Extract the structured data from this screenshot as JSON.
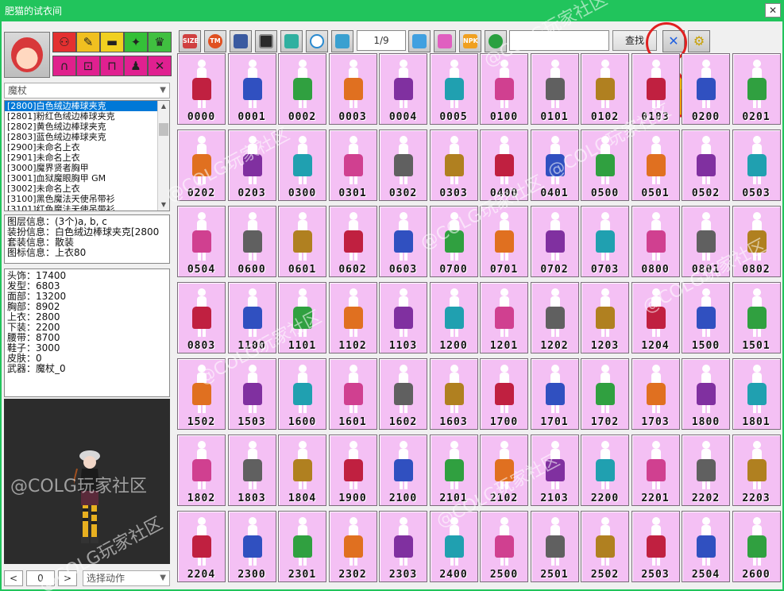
{
  "window": {
    "title": "肥猫的试衣间",
    "close_label": "✕"
  },
  "left": {
    "part_buttons": [
      "head-cap",
      "hair",
      "face",
      "neck",
      "coat",
      "pants",
      "belt",
      "shoes",
      "skin",
      "weapon"
    ],
    "weapon_select": "魔杖",
    "items": [
      "[2800]白色绒边棒球夹克",
      "[2801]粉红色绒边棒球夹克",
      "[2802]黄色绒边棒球夹克",
      "[2803]蓝色绒边棒球夹克",
      "[2900]未命名上衣",
      "[2901]未命名上衣",
      "[3000]魔界贤者胸甲",
      "[3001]血狱魔眼胸甲 GM",
      "[3002]未命名上衣",
      "[3100]黑色魔法天使吊带衫",
      "[3101]红色魔法天使吊带衫"
    ],
    "info": [
      "图层信息：(3个)a, b, c",
      "装扮信息：白色绒边棒球夹克[2800",
      "套装信息：散装",
      "图标信息：上衣80"
    ],
    "stats": [
      "头饰：17400",
      "发型：6803",
      "面部：13200",
      "胸部：8902",
      "上衣：2800",
      "下装：2200",
      "腰带：8700",
      "鞋子：3000",
      "皮肤：0",
      "武器：魔杖_0"
    ],
    "bottom": {
      "prev": "<",
      "frame": "0",
      "next": ">",
      "action_select": "选择动作"
    }
  },
  "toolbar": {
    "pager": "1/9",
    "search_button": "查找",
    "search_value": ""
  },
  "watermark": "@COLG玩家社区",
  "grid_codes": [
    [
      "0000",
      "0001",
      "0002",
      "0003",
      "0004",
      "0005",
      "0100",
      "0101",
      "0102",
      "0103",
      "0200",
      "0201"
    ],
    [
      "0202",
      "0203",
      "0300",
      "0301",
      "0302",
      "0303",
      "0400",
      "0401",
      "0500",
      "0501",
      "0502",
      "0503"
    ],
    [
      "0504",
      "0600",
      "0601",
      "0602",
      "0603",
      "0700",
      "0701",
      "0702",
      "0703",
      "0800",
      "0801",
      "0802"
    ],
    [
      "0803",
      "1100",
      "1101",
      "1102",
      "1103",
      "1200",
      "1201",
      "1202",
      "1203",
      "1204",
      "1500",
      "1501"
    ],
    [
      "1502",
      "1503",
      "1600",
      "1601",
      "1602",
      "1603",
      "1700",
      "1701",
      "1702",
      "1703",
      "1800",
      "1801"
    ],
    [
      "1802",
      "1803",
      "1804",
      "1900",
      "2100",
      "2101",
      "2102",
      "2103",
      "2200",
      "2201",
      "2202",
      "2203"
    ],
    [
      "2204",
      "2300",
      "2301",
      "2302",
      "2303",
      "2400",
      "2500",
      "2501",
      "2502",
      "2503",
      "2504",
      "2600"
    ]
  ],
  "colors": {
    "titlebar": "#21c45c",
    "cell_bg": "#f4c0f4",
    "highlight": "#e02020",
    "arrow": "#f5b800"
  }
}
